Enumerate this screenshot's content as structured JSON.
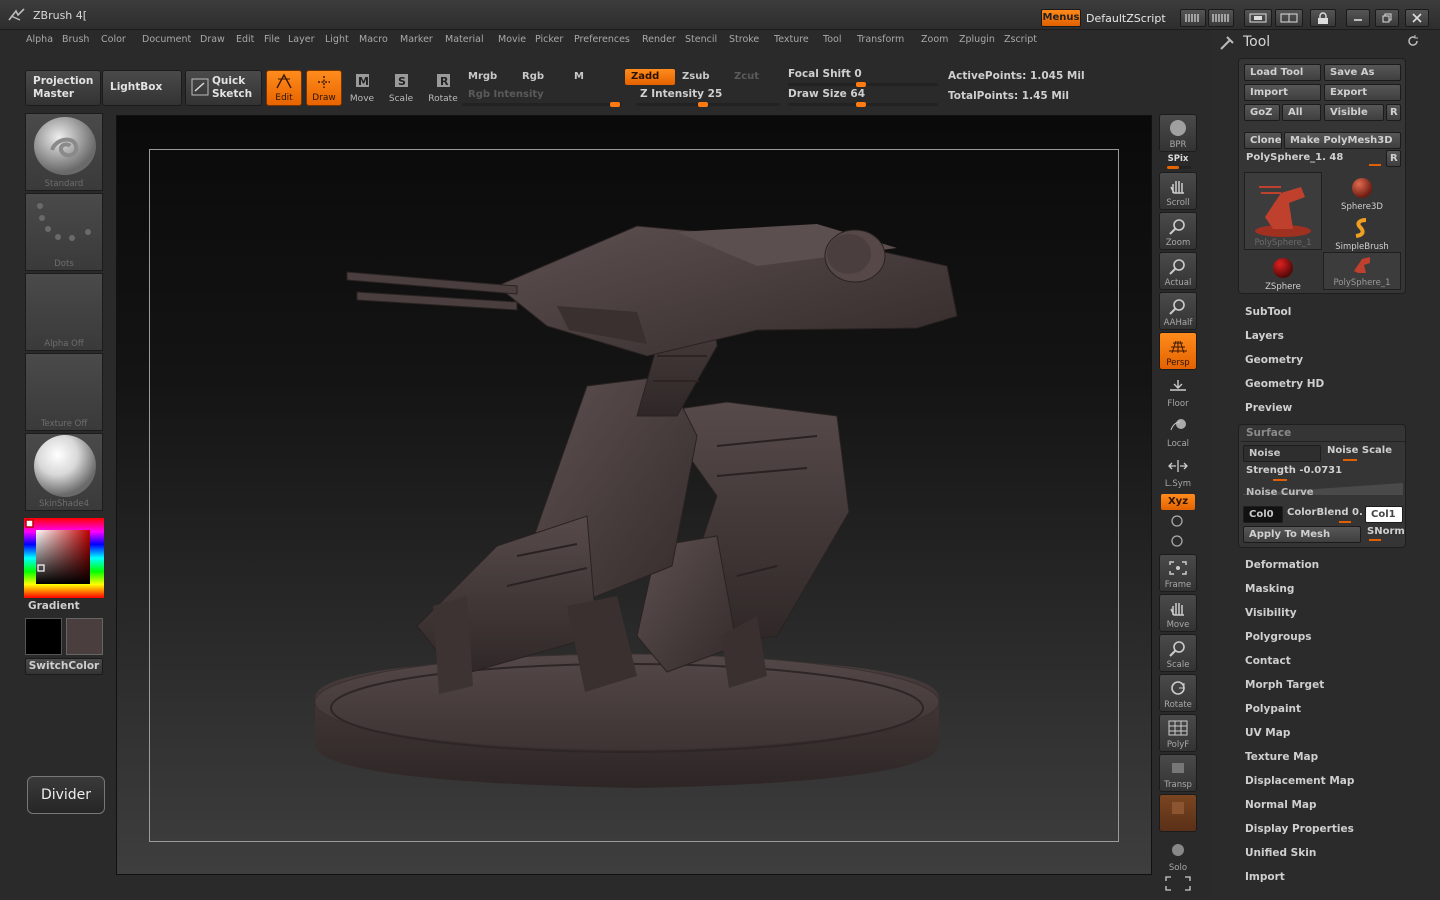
{
  "window": {
    "app_title": "ZBrush 4[",
    "menus_label": "Menus",
    "script_label": "DefaultZScript"
  },
  "menubar": {
    "items": [
      "Alpha",
      "Brush",
      "Color",
      "Document",
      "Draw",
      "Edit",
      "File",
      "Layer",
      "Light",
      "Macro",
      "Marker",
      "Material",
      "Movie",
      "Picker",
      "Preferences",
      "Render",
      "Stencil",
      "Stroke",
      "Texture",
      "Tool",
      "Transform",
      "Zoom",
      "Zplugin",
      "Zscript"
    ]
  },
  "toolbar": {
    "projection_master": "Projection Master",
    "lightbox": "LightBox",
    "quick_sketch": "Quick Sketch",
    "edit": "Edit",
    "draw": "Draw",
    "move": "Move",
    "scale": "Scale",
    "rotate": "Rotate",
    "mrgb": "Mrgb",
    "rgb": "Rgb",
    "m": "M",
    "zadd": "Zadd",
    "zsub": "Zsub",
    "zcut": "Zcut",
    "rgb_intensity": "Rgb  Intensity",
    "z_intensity": "Z Intensity 25",
    "z_intensity_value": 25,
    "focal_shift": "Focal Shift 0",
    "focal_shift_value": 0,
    "draw_size": "Draw Size 64",
    "draw_size_value": 64,
    "active_points": "ActivePoints: 1.045  Mil",
    "total_points": "TotalPoints: 1.45  Mil"
  },
  "left_shelf": {
    "brush": "Standard",
    "stroke": "Dots",
    "alpha": "Alpha  Off",
    "texture": "Texture  Off",
    "material": "SkinShade4",
    "gradient": "Gradient",
    "switch_color": "SwitchColor",
    "divider": "Divider",
    "primary_color": "#000000",
    "secondary_color": "#4a3e3e"
  },
  "right_shelf": {
    "bpr": "BPR",
    "spix": "SPix",
    "scroll": "Scroll",
    "zoom": "Zoom",
    "actual": "Actual",
    "aahalf": "AAHalf",
    "persp": "Persp",
    "floor": "Floor",
    "local": "Local",
    "lsym": "L.Sym",
    "xyz": "Xyz",
    "frame": "Frame",
    "move": "Move",
    "scale": "Scale",
    "rotate": "Rotate",
    "polyf": "PolyF",
    "transp": "Transp",
    "solo": "Solo"
  },
  "tool_palette": {
    "title": "Tool",
    "load_tool": "Load Tool",
    "save_as": "Save As",
    "import": "Import",
    "export": "Export",
    "goz": "GoZ",
    "all": "All",
    "visible": "Visible",
    "r": "R",
    "clone": "Clone",
    "make_polymesh": "Make PolyMesh3D",
    "current_tool": "PolySphere_1. 48",
    "tiles": {
      "current": "PolySphere_1",
      "sphere3d": "Sphere3D",
      "simplebrush": "SimpleBrush",
      "zsphere": "ZSphere",
      "polysphere": "PolySphere_1"
    },
    "sections_top": [
      "SubTool",
      "Layers",
      "Geometry",
      "Geometry HD",
      "Preview"
    ],
    "surface": {
      "title": "Surface",
      "noise": "Noise",
      "noise_scale": "Noise  Scale",
      "strength": "Strength -0.0731",
      "strength_value": -0.0731,
      "noise_curve": "Noise  Curve",
      "col0": "Col0",
      "color_blend": "ColorBlend 0.",
      "col1": "Col1",
      "apply_to_mesh": "Apply To Mesh",
      "snorm": "SNorm"
    },
    "sections_bottom": [
      "Deformation",
      "Masking",
      "Visibility",
      "Polygroups",
      "Contact",
      "Morph Target",
      "Polypaint",
      "UV Map",
      "Texture Map",
      "Displacement Map",
      "Normal Map",
      "Display Properties",
      "Unified Skin",
      "Import"
    ]
  },
  "colors": {
    "accent": "#e86400",
    "bg": "#2b2b2b",
    "model": "#4a3e3e"
  }
}
